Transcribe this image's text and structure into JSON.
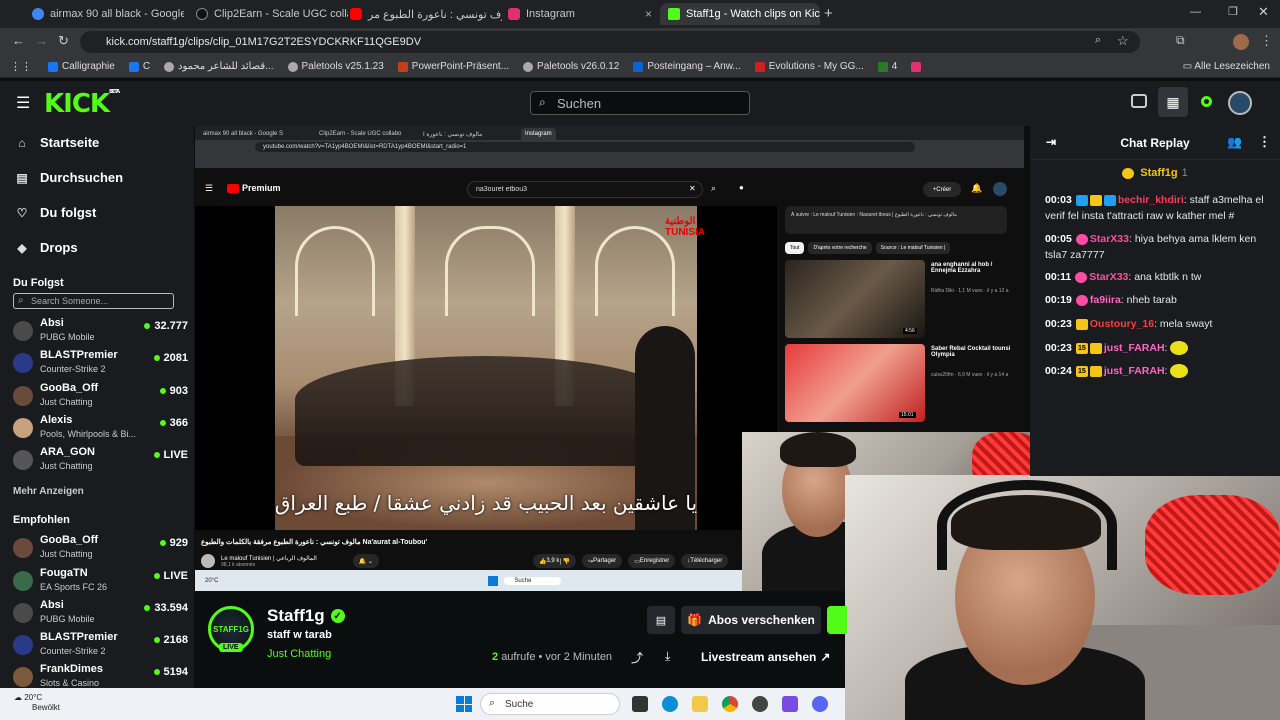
{
  "browser": {
    "tabs": [
      {
        "label": "airmax 90 all black - Google Su",
        "color": "#4285f4"
      },
      {
        "label": "Clip2Earn - Scale UGC collabora",
        "color": "#111111"
      },
      {
        "label": "مالوف تونسي : ناعورة الطبوع مر",
        "color": "#ff0000"
      },
      {
        "label": "Instagram",
        "color": "#e1306c"
      },
      {
        "label": "Staff1g - Watch clips on Kic",
        "color": "#53fc18"
      }
    ],
    "url": "kick.com/staff1g/clips/clip_01M17G2T2ESYDCKRKF11QGE9DV",
    "bookmarks": [
      "Calligraphie",
      "C",
      "قصائد للشاعر محمود...",
      "Paletools v25.1.23",
      "PowerPoint-Präsent...",
      "Paletools v26.0.12",
      "Posteingang – Anw...",
      "Evolutions - My GG...",
      "4"
    ],
    "all_bookmarks": "Alle Lesezeichen"
  },
  "header": {
    "logo": "KICK",
    "beta": "BETA",
    "search_placeholder": "Suchen"
  },
  "sidebar": {
    "nav": [
      {
        "label": "Startseite",
        "icon": "home-icon",
        "glyph": "⌂"
      },
      {
        "label": "Durchsuchen",
        "icon": "browse-icon",
        "glyph": "▤"
      },
      {
        "label": "Du folgst",
        "icon": "heart-icon",
        "glyph": "♡"
      },
      {
        "label": "Drops",
        "icon": "gift-icon",
        "glyph": "◆"
      }
    ],
    "following_title": "Du Folgst",
    "search_placeholder": "Search Someone...",
    "following": [
      {
        "name": "Absi",
        "category": "PUBG Mobile",
        "viewers": "32.777",
        "avatar": "#4a4a4a"
      },
      {
        "name": "BLASTPremier",
        "category": "Counter-Strike 2",
        "viewers": "2081",
        "avatar": "#2a3a8a"
      },
      {
        "name": "GooBa_Off",
        "category": "Just Chatting",
        "viewers": "903",
        "avatar": "#6a4a3a"
      },
      {
        "name": "Alexis",
        "category": "Pools, Whirlpools & Bi...",
        "viewers": "366",
        "avatar": "#c8a080"
      },
      {
        "name": "ARA_GON",
        "category": "Just Chatting",
        "viewers": "LIVE",
        "avatar": "#555555"
      }
    ],
    "show_more": "Mehr Anzeigen",
    "recommended_title": "Empfohlen",
    "recommended": [
      {
        "name": "GooBa_Off",
        "category": "Just Chatting",
        "viewers": "929",
        "avatar": "#6a4a3a"
      },
      {
        "name": "FougaTN",
        "category": "EA Sports FC 26",
        "viewers": "LIVE",
        "avatar": "#3a6a4a"
      },
      {
        "name": "Absi",
        "category": "PUBG Mobile",
        "viewers": "33.594",
        "avatar": "#4a4a4a"
      },
      {
        "name": "BLASTPremier",
        "category": "Counter-Strike 2",
        "viewers": "2168",
        "avatar": "#2a3a8a"
      },
      {
        "name": "FrankDimes",
        "category": "Slots & Casino",
        "viewers": "5194",
        "avatar": "#7a5a3a"
      }
    ]
  },
  "video": {
    "inner_tabs": [
      "airmax 90 all black - Google S",
      "Clip2Earn - Scale UGC collabo",
      "مالوف تونسي : ناعورة ا",
      "Instagram"
    ],
    "inner_url": "youtube.com/watch?v=TA1yp4BOEMI&list=RDTA1yp4BOEMI&start_radio=1",
    "yt_logo": "Premium",
    "yt_search": "na3ouret etbou3",
    "create": "Créer",
    "subtitle": "يا عاشقين بعد الحبيب قد زادني عشقا / طبع العراق",
    "watermark": "الوطنية TUNISIA",
    "title": "مالوف تونسي : ناعورة الطبوع مرفقة بالكلمات والطبوع Na'aurat al-Toubou'",
    "channel": "Le malouf Tunisien | المالوف الرباعي",
    "subs": "98,1 k abonnés",
    "likes": "3,9 k",
    "share": "Partager",
    "save": "Enregistrer",
    "download": "Télécharger",
    "next_up": "À suivre : Le malouf Tunisien : Naouret tbous | مالوف تونسي : ناعورة الطبوع",
    "chips": [
      "Tout",
      "D'après votre recherche",
      "Source : Le malouf Tunisien |"
    ],
    "suggestions": [
      {
        "title": "ana enghanni al hob / Ennejma Ezzahra",
        "meta": "Ridha Diki · 1,1 M vues · il y a 12 a",
        "duration": "4:56"
      },
      {
        "title": "Saber Rebai Cocktail tounsi Olympia",
        "meta": "cuiss20fm · 6,9 M vues · il y a 14 a",
        "duration": "15:01"
      }
    ],
    "inner_search": "Suche",
    "inner_weather": "20°C"
  },
  "channel": {
    "name": "Staff1g",
    "title": "staff w tarab",
    "category": "Just Chatting",
    "live": "LIVE",
    "avatar_text": "STAFF1G",
    "gift_button": "Abos verschenken",
    "views_count": "2",
    "views_label": "aufrufe",
    "time_ago": "• vor 2 Minuten",
    "livestream_link": "Livestream ansehen"
  },
  "chat": {
    "title": "Chat Replay",
    "pinned_user": "Staff1g",
    "pinned_count": "1",
    "messages": [
      {
        "time": "00:03",
        "user": "bechir_khdiri",
        "color": "#ff3b5c",
        "text": "staff a3melha el verif fel insta t'attracti raw w kather mel #",
        "badges": [
          "#1da1f2",
          "#f5c518",
          "#1da1f2"
        ]
      },
      {
        "time": "00:05",
        "user": "StarX33",
        "color": "#ff4da6",
        "text": "hiya behya ama lklem ken tsla7 za7777",
        "badges": [
          "#ff4da6"
        ]
      },
      {
        "time": "00:11",
        "user": "StarX33",
        "color": "#ff4da6",
        "text": "ana ktbtlk n tw",
        "badges": [
          "#ff4da6"
        ]
      },
      {
        "time": "00:19",
        "user": "fa9iira",
        "color": "#ff66c4",
        "text": "nheb tarab",
        "badges": [
          "#ff4da6"
        ]
      },
      {
        "time": "00:23",
        "user": "Oustoury_16",
        "color": "#ff3b3b",
        "text": "mela swayt",
        "badges": [
          "#f5c518"
        ]
      },
      {
        "time": "00:23",
        "user": "just_FARAH",
        "color": "#ff66c4",
        "text": "",
        "badges": [
          "#f5c518",
          "#f5c518"
        ]
      },
      {
        "time": "00:24",
        "user": "just_FARAH",
        "color": "#ff66c4",
        "text": "",
        "badges": [
          "#f5c518",
          "#f5c518"
        ]
      }
    ]
  },
  "taskbar": {
    "temp": "20°C",
    "weather": "Bewölkt",
    "search": "Suche"
  }
}
